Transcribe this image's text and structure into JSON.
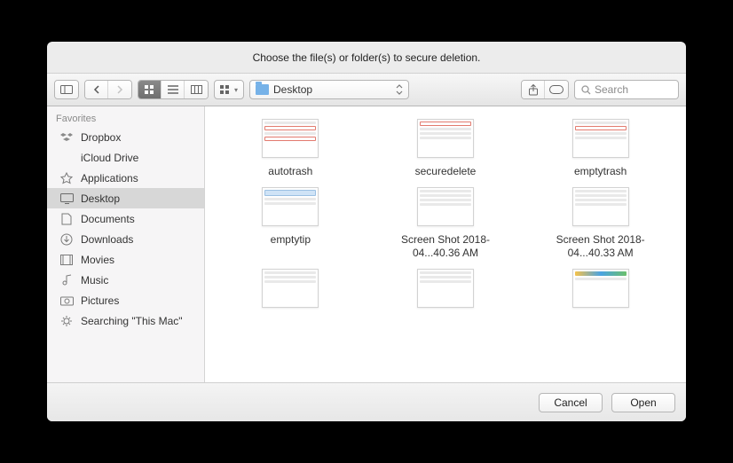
{
  "title": "Choose the file(s) or folder(s) to secure deletion.",
  "toolbar": {
    "location_label": "Desktop",
    "search_placeholder": "Search"
  },
  "sidebar": {
    "heading": "Favorites",
    "items": [
      {
        "label": "Dropbox"
      },
      {
        "label": "iCloud Drive"
      },
      {
        "label": "Applications"
      },
      {
        "label": "Desktop"
      },
      {
        "label": "Documents"
      },
      {
        "label": "Downloads"
      },
      {
        "label": "Movies"
      },
      {
        "label": "Music"
      },
      {
        "label": "Pictures"
      },
      {
        "label": "Searching \"This Mac\""
      }
    ]
  },
  "files": [
    {
      "label": "autotrash"
    },
    {
      "label": "securedelete"
    },
    {
      "label": "emptytrash"
    },
    {
      "label": "emptytip"
    },
    {
      "label": "Screen Shot 2018-04...40.36 AM"
    },
    {
      "label": "Screen Shot 2018-04...40.33 AM"
    },
    {
      "label": ""
    },
    {
      "label": ""
    },
    {
      "label": ""
    }
  ],
  "footer": {
    "cancel": "Cancel",
    "open": "Open"
  }
}
